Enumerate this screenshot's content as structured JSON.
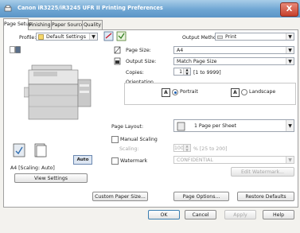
{
  "window": {
    "title": "Canon iR3225/iR3245 UFR II Printing Preferences",
    "close_label": "X"
  },
  "tabs": [
    {
      "label": "Page Setup"
    },
    {
      "label": "Finishing"
    },
    {
      "label": "Paper Source"
    },
    {
      "label": "Quality"
    }
  ],
  "profile": {
    "label": "Profile:",
    "value": "Default Settings"
  },
  "output_method": {
    "label": "Output Method:",
    "value": "Print"
  },
  "page_size": {
    "label": "Page Size:",
    "value": "A4"
  },
  "output_size": {
    "label": "Output Size:",
    "value": "Match Page Size"
  },
  "copies": {
    "label": "Copies:",
    "value": "1",
    "range": "[1 to 9999]"
  },
  "orientation": {
    "label": "Orientation",
    "portrait_label": "Portrait",
    "landscape_label": "Landscape",
    "selected": "Portrait"
  },
  "page_layout": {
    "label": "Page Layout:",
    "value": "1 Page per Sheet"
  },
  "manual_scaling": {
    "label": "Manual Scaling",
    "checked": false
  },
  "scaling": {
    "label": "Scaling:",
    "value": "100",
    "range": "% [25 to 200]"
  },
  "watermark": {
    "label": "Watermark",
    "checked": false,
    "value": "CONFIDENTIAL",
    "edit_label": "Edit Watermark..."
  },
  "preview": {
    "auto_badge": "Auto",
    "status_text": "A4 [Scaling: Auto]"
  },
  "buttons": {
    "view_settings": "View Settings",
    "custom_paper_size": "Custom Paper Size...",
    "page_options": "Page Options...",
    "restore_defaults": "Restore Defaults",
    "ok": "OK",
    "cancel": "Cancel",
    "apply": "Apply",
    "help": "Help"
  },
  "colors": {
    "titlebar": "#6fa6d3",
    "selection_accent": "#1a5fb4"
  }
}
